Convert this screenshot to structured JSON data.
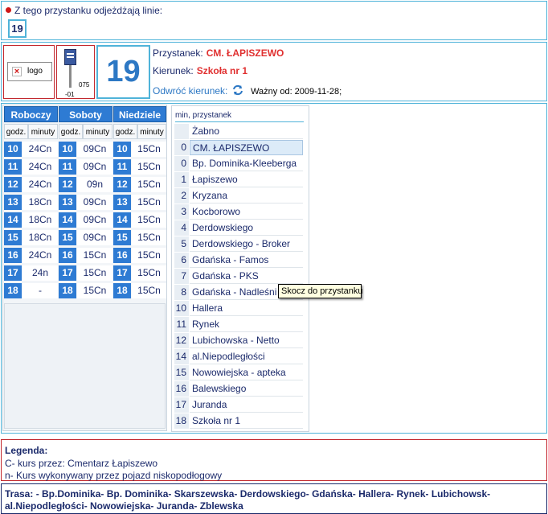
{
  "lines_header": {
    "label": "Z tego przystanku odjeżdżają linie:",
    "lines": [
      "19"
    ]
  },
  "header": {
    "logo_alt": "logo",
    "pole_code_top": "075",
    "pole_code_bottom": "-01",
    "line_number": "19",
    "stop_label": "Przystanek:",
    "stop_name": "CM. ŁAPISZEWO",
    "direction_label": "Kierunek:",
    "direction_name": "Szkoła nr 1",
    "reverse_label": "Odwróć kierunek:",
    "valid_label": "Ważny od: 2009-11-28;"
  },
  "timetable": {
    "tabs": [
      "Roboczy",
      "Soboty",
      "Niedziele"
    ],
    "col_hour": "godz.",
    "col_minutes": "minuty",
    "rows": [
      {
        "h1": "10",
        "m1": "24Cn",
        "h2": "10",
        "m2": "09Cn",
        "h3": "10",
        "m3": "15Cn"
      },
      {
        "h1": "11",
        "m1": "24Cn",
        "h2": "11",
        "m2": "09Cn",
        "h3": "11",
        "m3": "15Cn"
      },
      {
        "h1": "12",
        "m1": "24Cn",
        "h2": "12",
        "m2": "09n",
        "h3": "12",
        "m3": "15Cn"
      },
      {
        "h1": "13",
        "m1": "18Cn",
        "h2": "13",
        "m2": "09Cn",
        "h3": "13",
        "m3": "15Cn"
      },
      {
        "h1": "14",
        "m1": "18Cn",
        "h2": "14",
        "m2": "09Cn",
        "h3": "14",
        "m3": "15Cn"
      },
      {
        "h1": "15",
        "m1": "18Cn",
        "h2": "15",
        "m2": "09Cn",
        "h3": "15",
        "m3": "15Cn"
      },
      {
        "h1": "16",
        "m1": "24Cn",
        "h2": "16",
        "m2": "15Cn",
        "h3": "16",
        "m3": "15Cn"
      },
      {
        "h1": "17",
        "m1": "24n",
        "h2": "17",
        "m2": "15Cn",
        "h3": "17",
        "m3": "15Cn"
      },
      {
        "h1": "18",
        "m1": "-",
        "h2": "18",
        "m2": "15Cn",
        "h3": "18",
        "m3": "15Cn"
      }
    ]
  },
  "stops": {
    "header": "min, przystanek",
    "tooltip": "Skocz do przystanku",
    "items": [
      {
        "min": "",
        "name": "Żabno"
      },
      {
        "min": "0",
        "name": "CM. ŁAPISZEWO",
        "current": true
      },
      {
        "min": "0",
        "name": "Bp. Dominika-Kleeberga"
      },
      {
        "min": "1",
        "name": "Łapiszewo"
      },
      {
        "min": "2",
        "name": "Kryzana"
      },
      {
        "min": "3",
        "name": "Kocborowo"
      },
      {
        "min": "4",
        "name": "Derdowskiego"
      },
      {
        "min": "5",
        "name": "Derdowskiego - Broker"
      },
      {
        "min": "6",
        "name": "Gdańska - Famos"
      },
      {
        "min": "7",
        "name": "Gdańska - PKS"
      },
      {
        "min": "8",
        "name": "Gdańska - Nadleśni"
      },
      {
        "min": "10",
        "name": "Hallera"
      },
      {
        "min": "11",
        "name": "Rynek"
      },
      {
        "min": "12",
        "name": "Lubichowska - Netto"
      },
      {
        "min": "14",
        "name": "al.Niepodległości"
      },
      {
        "min": "15",
        "name": "Nowowiejska - apteka"
      },
      {
        "min": "16",
        "name": "Balewskiego"
      },
      {
        "min": "17",
        "name": "Juranda"
      },
      {
        "min": "18",
        "name": "Szkoła nr 1"
      }
    ]
  },
  "legend": {
    "title": "Legenda:",
    "items": [
      "C- kurs przez: Cmentarz Łapiszewo",
      "n- Kurs wykonywany przez pojazd niskopodłogowy"
    ]
  },
  "route": {
    "text": "Trasa: - Bp.Dominika- Bp. Dominika- Skarszewska- Derdowskiego- Gdańska- Hallera- Rynek- Lubichowsk- al.Niepodległości- Nowowiejska- Juranda- Zblewska"
  },
  "colors": {
    "accent_blue": "#2e7bd3",
    "frame_cyan": "#4fb3d9",
    "frame_red": "#c2282e",
    "text_red": "#e03030"
  }
}
